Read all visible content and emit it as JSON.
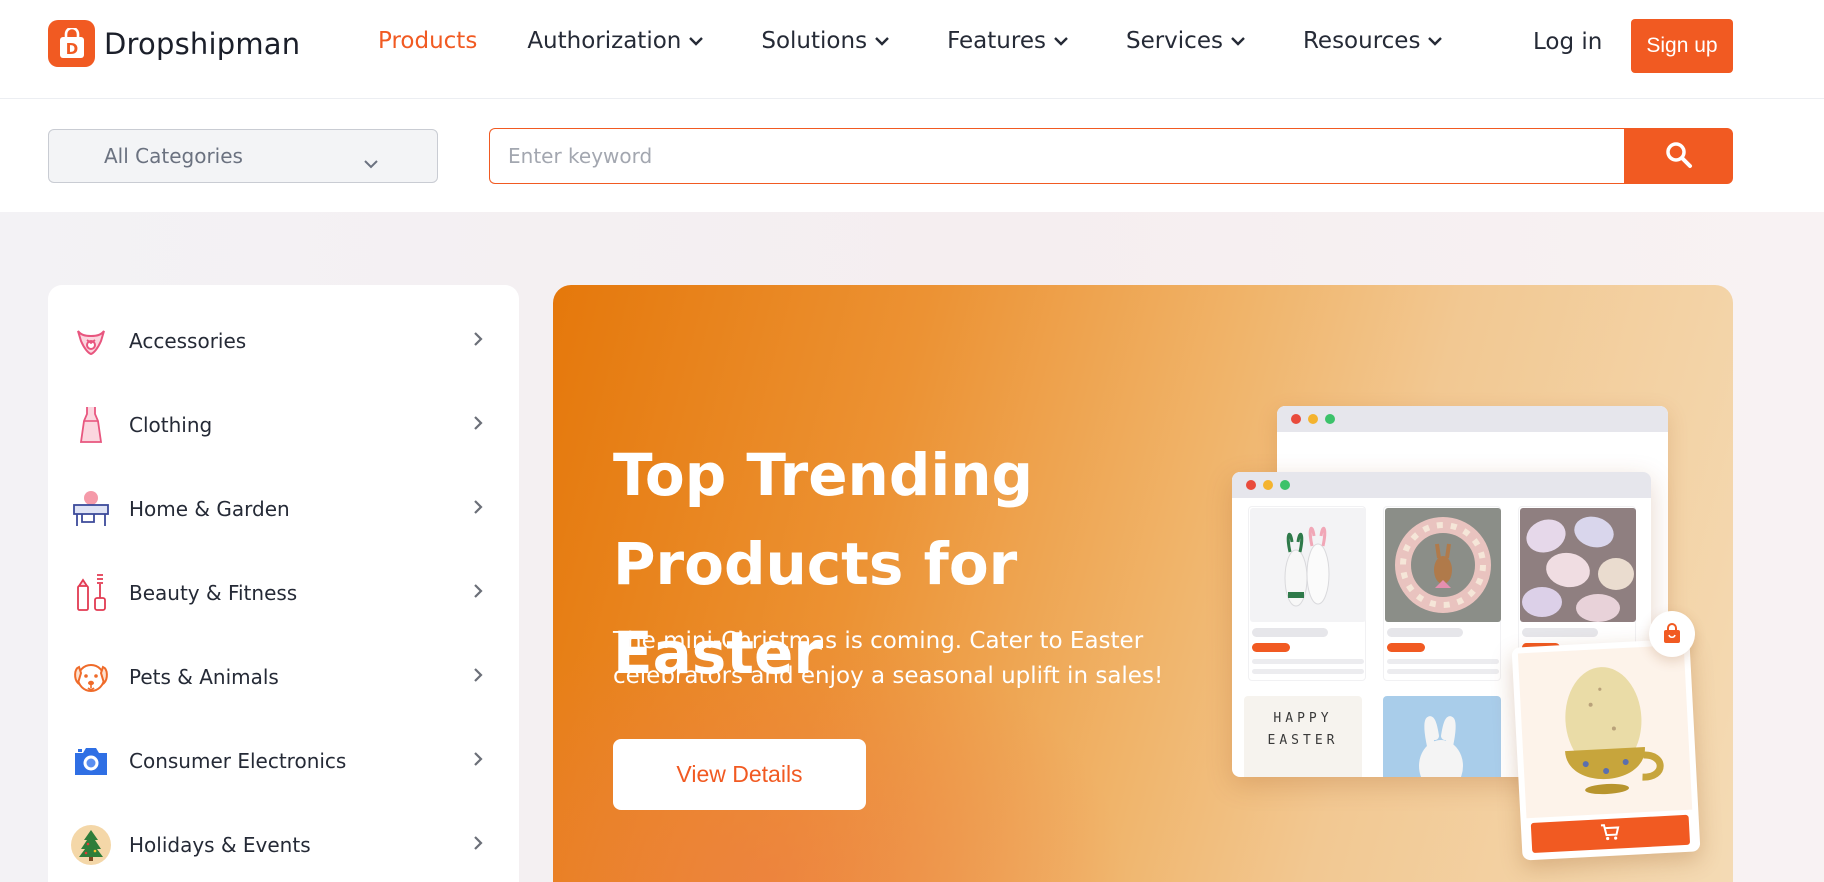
{
  "brand": {
    "name": "Dropshipman",
    "accent_color": "#f15a22",
    "logo_icon": "shopping-bag-d-icon"
  },
  "nav": {
    "items": [
      {
        "label": "Products",
        "active": true,
        "has_dropdown": false
      },
      {
        "label": "Authorization",
        "active": false,
        "has_dropdown": true
      },
      {
        "label": "Solutions",
        "active": false,
        "has_dropdown": true
      },
      {
        "label": "Features",
        "active": false,
        "has_dropdown": true
      },
      {
        "label": "Services",
        "active": false,
        "has_dropdown": true
      },
      {
        "label": "Resources",
        "active": false,
        "has_dropdown": true
      }
    ],
    "login_label": "Log in",
    "signup_label": "Sign up"
  },
  "search": {
    "category_value": "All Categories",
    "placeholder": "Enter keyword",
    "value": "",
    "button_icon": "search-icon"
  },
  "sidebar": {
    "items": [
      {
        "label": "Accessories",
        "icon": "necklace-icon"
      },
      {
        "label": "Clothing",
        "icon": "dress-icon"
      },
      {
        "label": "Home & Garden",
        "icon": "furniture-icon"
      },
      {
        "label": "Beauty & Fitness",
        "icon": "cosmetics-icon"
      },
      {
        "label": "Pets & Animals",
        "icon": "dog-icon"
      },
      {
        "label": "Consumer Electronics",
        "icon": "camera-icon"
      },
      {
        "label": "Holidays & Events",
        "icon": "christmas-tree-icon"
      }
    ]
  },
  "hero": {
    "title_line1": "Top Trending",
    "title_line2": "Products for Easter",
    "subtitle": "The mini-Christmas is coming. Cater to Easter celebrators and enjoy a seasonal uplift in sales!",
    "button_label": "View Details",
    "illustration": {
      "card_text_line1": "HAPPY",
      "card_text_line2": "EASTER",
      "cart_icon": "cart-icon",
      "bag_icon": "shopping-bag-icon"
    }
  }
}
